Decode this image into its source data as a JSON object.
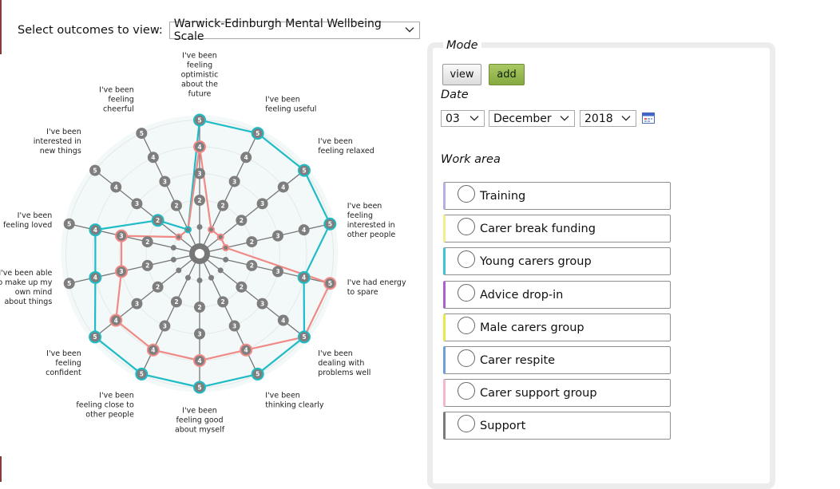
{
  "outcome_selector": {
    "label": "Select outcomes to view:",
    "selected": "Warwick-Edinburgh Mental Wellbeing Scale"
  },
  "chart_data": {
    "type": "radar",
    "scale": [
      1,
      2,
      3,
      4,
      5
    ],
    "axes": [
      [
        "I've been",
        "feeling",
        "optimistic",
        "about the",
        "future"
      ],
      [
        "I've been",
        "feeling useful"
      ],
      [
        "I've been",
        "feeling relaxed"
      ],
      [
        "I've been",
        "feeling",
        "interested in",
        "other people"
      ],
      [
        "I've had energy",
        "to spare"
      ],
      [
        "I've been",
        "dealing with",
        "problems well"
      ],
      [
        "I've been",
        "thinking clearly"
      ],
      [
        "I've been",
        "feeling good",
        "about myself"
      ],
      [
        "I've been",
        "feeling close to",
        "other people"
      ],
      [
        "I've been",
        "feeling",
        "confident"
      ],
      [
        "I've been able",
        "to make up my",
        "own mind",
        "about things"
      ],
      [
        "I've been",
        "feeling loved"
      ],
      [
        "I've been",
        "interested in",
        "new things"
      ],
      [
        "I've been",
        "feeling",
        "cheerful"
      ]
    ],
    "series": [
      {
        "color": "#1fbcc6",
        "values": [
          5,
          5,
          5,
          5,
          4,
          5,
          5,
          5,
          5,
          5,
          4,
          4,
          2,
          1
        ]
      },
      {
        "color": "#f08a86",
        "values": [
          4,
          1,
          1,
          1,
          5,
          5,
          4,
          4,
          4,
          4,
          3,
          3,
          1,
          1
        ]
      }
    ],
    "grid": true
  },
  "mode_panel": {
    "title": "Mode",
    "view_label": "view",
    "add_label": "add",
    "date_label": "Date",
    "day": "03",
    "month": "December",
    "year": "2018",
    "work_area_label": "Work area",
    "work_areas": [
      {
        "label": "Training",
        "color": "#b5b0dc"
      },
      {
        "label": "Carer break funding",
        "color": "#f2ee8a"
      },
      {
        "label": "Young carers group",
        "color": "#41c3d3"
      },
      {
        "label": "Advice drop-in",
        "color": "#a862cf"
      },
      {
        "label": "Male carers group",
        "color": "#e8e84c"
      },
      {
        "label": "Carer respite",
        "color": "#6b9fd8"
      },
      {
        "label": "Carer support group",
        "color": "#f6b8cc"
      },
      {
        "label": "Support",
        "color": "#7a7a7a"
      }
    ]
  }
}
